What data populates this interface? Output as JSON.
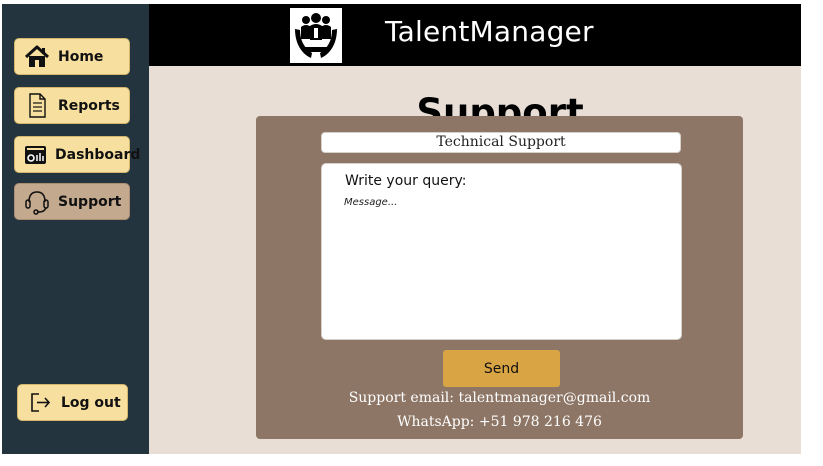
{
  "app": {
    "title": "TalentManager"
  },
  "sidebar": {
    "items": [
      {
        "label": "Home",
        "icon": "home-icon"
      },
      {
        "label": "Reports",
        "icon": "document-icon"
      },
      {
        "label": "Dashboard",
        "icon": "dashboard-icon"
      },
      {
        "label": "Support",
        "icon": "headset-icon"
      }
    ],
    "logout": {
      "label": "Log out",
      "icon": "logout-icon"
    }
  },
  "page": {
    "title": "Support"
  },
  "support": {
    "subject": "Technical Support",
    "query_label": "Write your query:",
    "message_placeholder": "Message...",
    "send_label": "Send",
    "contact_email": "Support email: talentmanager@gmail.com",
    "contact_whatsapp": "WhatsApp: +51 978 216 476"
  },
  "colors": {
    "sidebar": "#24343f",
    "nav_button": "#f7df9f",
    "active_nav_button": "#c3a98d",
    "topbar": "#000000",
    "content_background": "#e8ded6",
    "card": "#8d7666",
    "send_button": "#d9a443"
  }
}
